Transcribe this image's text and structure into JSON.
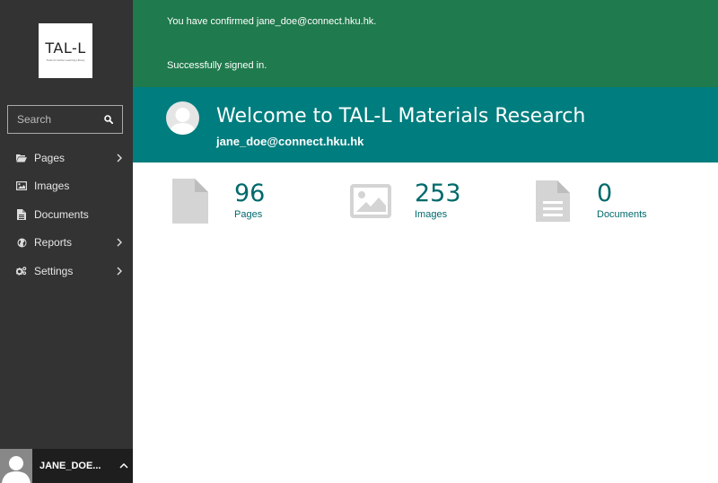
{
  "sidebar": {
    "logo": {
      "text": "TAL-L",
      "subtext": "Tools for Active Learning Library"
    },
    "search": {
      "placeholder": "Search",
      "icon": "search-icon"
    },
    "menu": [
      {
        "label": "Pages",
        "icon": "folder-open-icon",
        "has_submenu": true
      },
      {
        "label": "Images",
        "icon": "image-icon",
        "has_submenu": false
      },
      {
        "label": "Documents",
        "icon": "document-icon",
        "has_submenu": false
      },
      {
        "label": "Reports",
        "icon": "globe-icon",
        "has_submenu": true
      },
      {
        "label": "Settings",
        "icon": "cogs-icon",
        "has_submenu": true
      }
    ],
    "account": {
      "name": "JANE_DOE...",
      "toggle_icon": "chevron-up-icon"
    }
  },
  "messages": [
    "You have confirmed jane_doe@connect.hku.hk.",
    "Successfully signed in."
  ],
  "header": {
    "title": "Welcome to TAL-L Materials Research",
    "user": "jane_doe@connect.hku.hk"
  },
  "summary": [
    {
      "count": "96",
      "label": "Pages",
      "icon": "page-icon"
    },
    {
      "count": "253",
      "label": "Images",
      "icon": "image-icon"
    },
    {
      "count": "0",
      "label": "Documents",
      "icon": "document-icon"
    }
  ],
  "colors": {
    "sidebar_bg": "#333333",
    "messages_bg": "#1f7a4d",
    "header_bg": "#007d7e",
    "stat_text": "#00696b",
    "stat_icon": "#d4d4d4"
  }
}
